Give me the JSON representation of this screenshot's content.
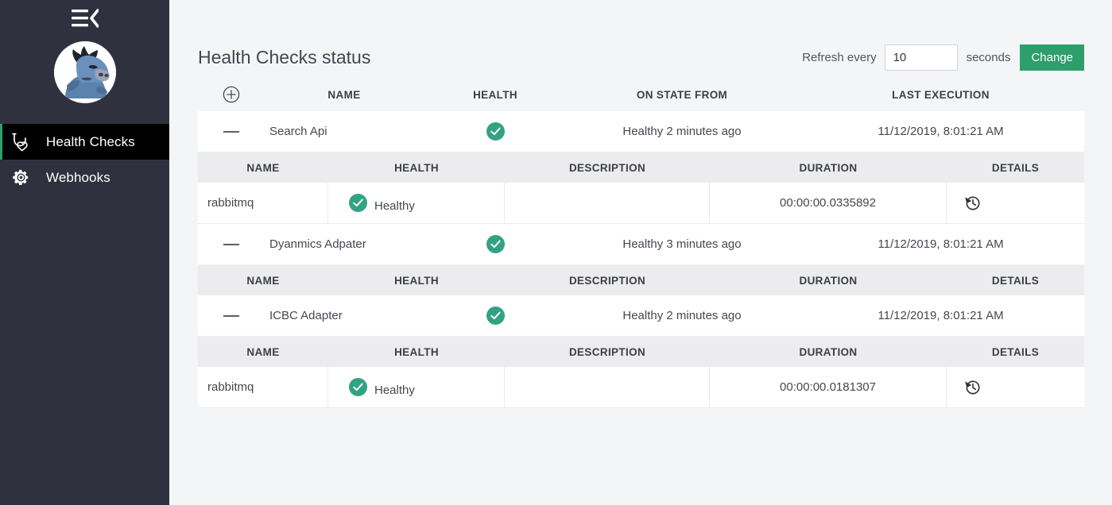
{
  "sidebar": {
    "collapse_icon": "menu-fold-icon",
    "avatar_icon": "avatar",
    "items": [
      {
        "label": "Health Checks",
        "icon": "stethoscope-heart-icon",
        "active": true
      },
      {
        "label": "Webhooks",
        "icon": "gear-icon",
        "active": false
      }
    ]
  },
  "header": {
    "title": "Health Checks status",
    "refresh_label": "Refresh every",
    "refresh_value": "10",
    "refresh_placeholder": "10",
    "seconds_label": "seconds",
    "change_label": "Change"
  },
  "colors": {
    "sidebar_bg": "#2f323e",
    "sidebar_active_bg": "#000000",
    "accent_green": "#2e9e6b",
    "health_green": "#32a382",
    "page_bg": "#f4f5f7",
    "sub_header_bg": "#ececee"
  },
  "table": {
    "expand_icon": "plus-circle-icon",
    "columns": [
      "NAME",
      "HEALTH",
      "ON STATE FROM",
      "LAST EXECUTION"
    ],
    "sub_columns": [
      "NAME",
      "HEALTH",
      "DESCRIPTION",
      "DURATION",
      "DETAILS"
    ],
    "groups": [
      {
        "toggle_icon": "minus-icon",
        "name": "Search Api",
        "health_icon": "check-circle-icon",
        "on_state_from": "Healthy 2 minutes ago",
        "last_execution": "11/12/2019, 8:01:21 AM",
        "entries": [
          {
            "name": "rabbitmq",
            "health_icon": "check-circle-icon",
            "health": "Healthy",
            "description": "",
            "duration": "00:00:00.0335892",
            "details_icon": "history-icon"
          }
        ]
      },
      {
        "toggle_icon": "minus-icon",
        "name": "Dyanmics Adpater",
        "health_icon": "check-circle-icon",
        "on_state_from": "Healthy 3 minutes ago",
        "last_execution": "11/12/2019, 8:01:21 AM",
        "entries": []
      },
      {
        "toggle_icon": "minus-icon",
        "name": "ICBC Adapter",
        "health_icon": "check-circle-icon",
        "on_state_from": "Healthy 2 minutes ago",
        "last_execution": "11/12/2019, 8:01:21 AM",
        "entries": [
          {
            "name": "rabbitmq",
            "health_icon": "check-circle-icon",
            "health": "Healthy",
            "description": "",
            "duration": "00:00:00.0181307",
            "details_icon": "history-icon"
          }
        ]
      }
    ]
  }
}
